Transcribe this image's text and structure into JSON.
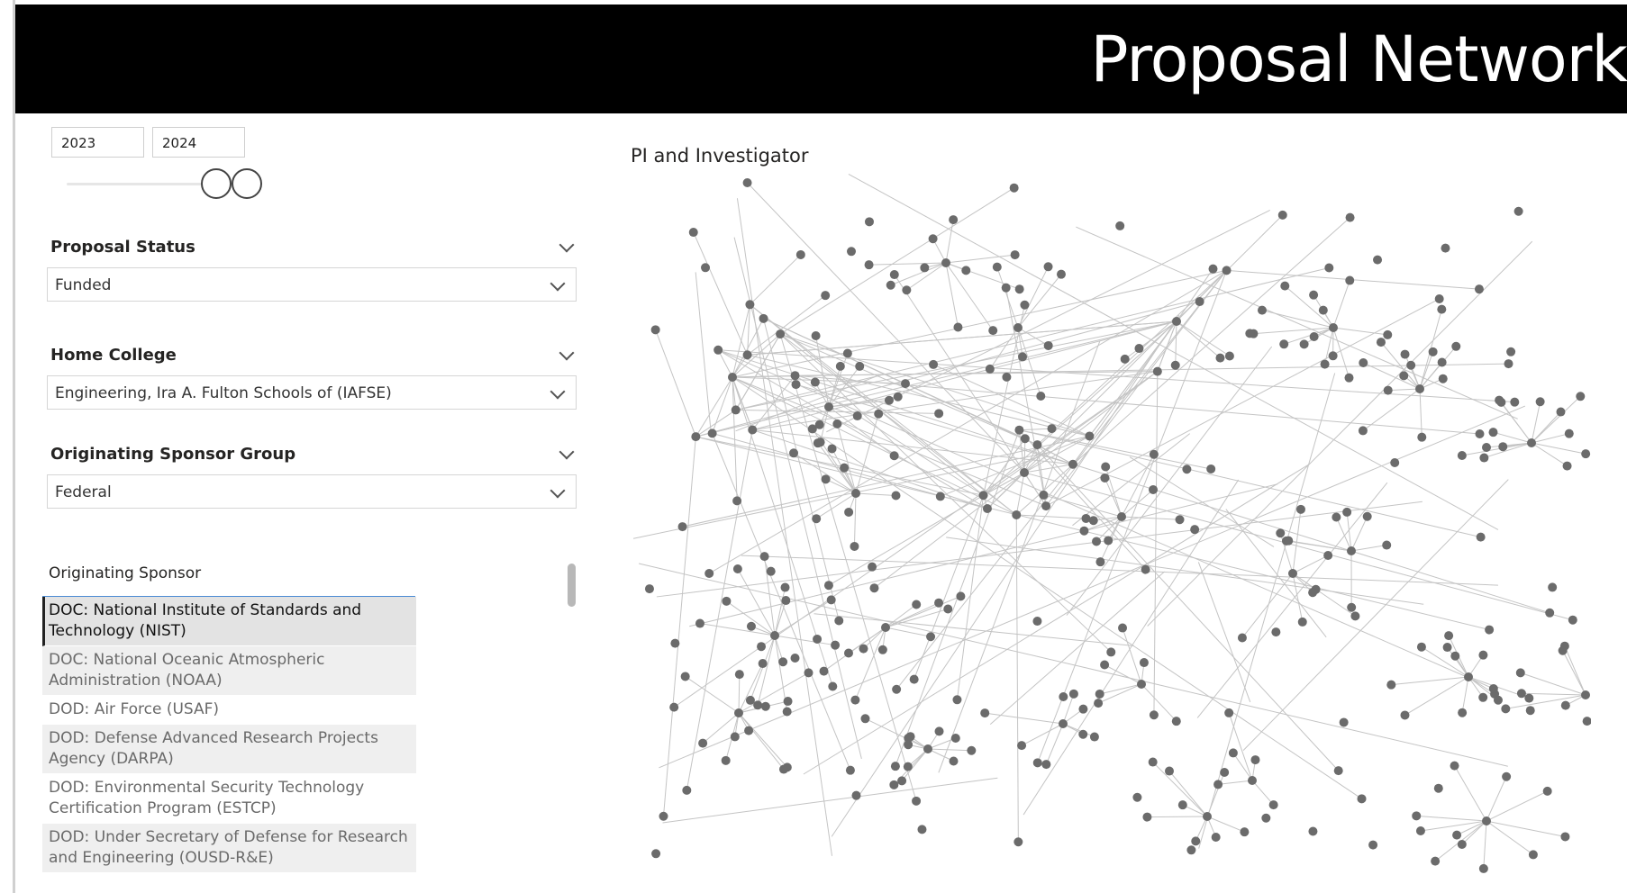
{
  "header": {
    "title": "Proposal Network"
  },
  "year_range": {
    "start": "2023",
    "end": "2024"
  },
  "filters": {
    "proposal_status": {
      "title": "Proposal Status",
      "value": "Funded"
    },
    "home_college": {
      "title": "Home College",
      "value": "Engineering, Ira A. Fulton Schools of (IAFSE)"
    },
    "sponsor_group": {
      "title": "Originating Sponsor Group",
      "value": "Federal"
    }
  },
  "sponsor_list": {
    "title": "Originating Sponsor",
    "items": [
      "DOC: National Institute of Standards and Technology (NIST)",
      "DOC: National Oceanic Atmospheric Administration (NOAA)",
      "DOD: Air Force (USAF)",
      "DOD: Defense Advanced Research Projects Agency (DARPA)",
      "DOD: Environmental Security Technology Certification Program (ESTCP)",
      "DOD: Under Secretary of Defense for Research and Engineering (OUSD-R&E)"
    ],
    "selected_index": 0
  },
  "network": {
    "title": "PI and Investigator",
    "node_color": "#6b6b6b",
    "edge_color": "#c4c4c4"
  }
}
